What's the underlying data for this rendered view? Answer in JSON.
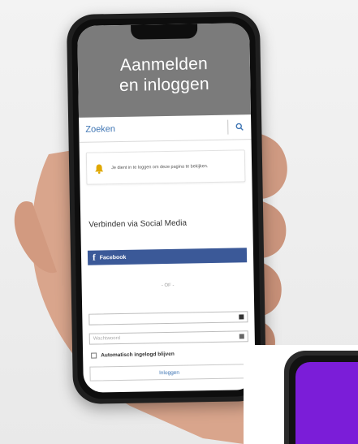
{
  "header": {
    "line1": "Aanmelden",
    "line2": "en inloggen"
  },
  "search": {
    "placeholder": "Zoeken"
  },
  "notice": {
    "text": "Je dient in te loggen om deze pagina te bekijken."
  },
  "social": {
    "title": "Verbinden via Social Media",
    "facebook_label": "Facebook"
  },
  "separator": "- OF -",
  "form": {
    "username_value": "",
    "password_placeholder": "Wachtwoord",
    "remember_label": "Automatisch ingelogd blijven",
    "login_label": "Inloggen"
  },
  "colors": {
    "header_bg": "#7b7b7b",
    "link_blue": "#3d74b3",
    "facebook_blue": "#3b5998",
    "bell_yellow": "#e0a800",
    "second_phone_screen": "#7b1dd8"
  }
}
